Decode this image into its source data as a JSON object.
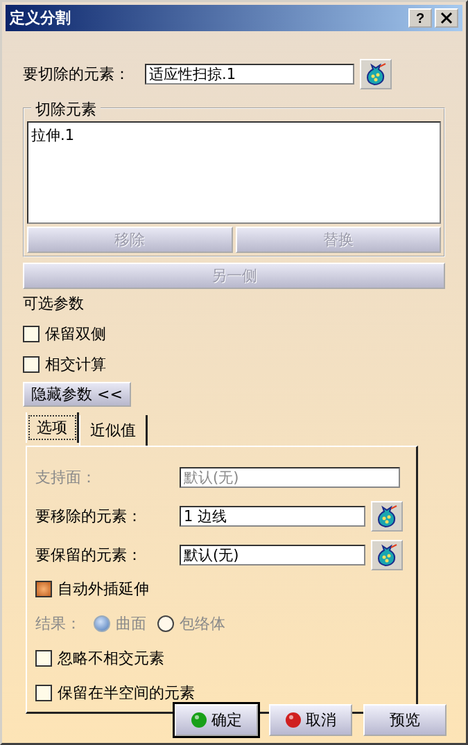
{
  "window": {
    "title": "定义分割",
    "help_button": "?"
  },
  "element_to_cut": {
    "label": "要切除的元素：",
    "value": "适应性扫掠.1"
  },
  "cutting_elements": {
    "title": "切除元素",
    "items": [
      {
        "label": "拉伸.1",
        "selected": false
      }
    ],
    "buttons": [
      {
        "label": "移除",
        "disabled": true
      },
      {
        "label": "替换",
        "disabled": true
      }
    ]
  },
  "other_side": {
    "label": "另一侧",
    "disabled": true
  },
  "optional_params": {
    "title": "可选参数",
    "options": [
      {
        "label": "保留双侧",
        "checked": false
      },
      {
        "label": "相交计算",
        "checked": false
      }
    ]
  },
  "hide_params_button": "隐藏参数 <<",
  "tabs": [
    {
      "label": "选项",
      "selected": true
    },
    {
      "label": "近似值",
      "selected": false
    }
  ],
  "panel": {
    "fields": [
      {
        "label": "支持面：",
        "value": "默认(无)",
        "disabled": true,
        "picker": false
      },
      {
        "label": "要移除的元素：",
        "value": "1 边线",
        "disabled": false,
        "picker": true
      },
      {
        "label": "要保留的元素：",
        "value": "默认(无)",
        "disabled": false,
        "picker": true
      }
    ],
    "extrapolate": {
      "label": "自动外插延伸",
      "checked": true
    },
    "result": {
      "label": "结果：",
      "disabled": true,
      "options": [
        {
          "label": "曲面",
          "selected": true
        },
        {
          "label": "包络体",
          "selected": false
        }
      ]
    },
    "checks": [
      {
        "label": "忽略不相交元素",
        "checked": false
      },
      {
        "label": "保留在半空间的元素",
        "checked": false
      }
    ]
  },
  "buttons": [
    {
      "label": "确定",
      "kind": "ok",
      "default": true
    },
    {
      "label": "取消",
      "kind": "cancel",
      "default": false
    },
    {
      "label": "预览",
      "kind": "preview",
      "default": false
    }
  ]
}
